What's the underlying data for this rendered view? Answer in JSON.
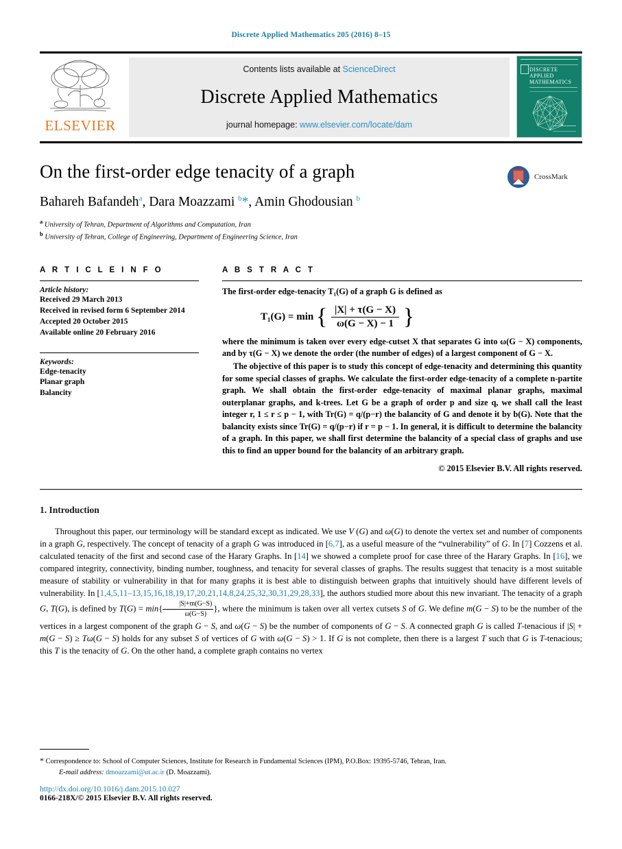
{
  "running_head": "Discrete Applied Mathematics 205 (2016) 8–15",
  "masthead": {
    "publisher_name": "ELSEVIER",
    "contents_prefix": "Contents lists available at ",
    "contents_link": "ScienceDirect",
    "journal_title": "Discrete Applied Mathematics",
    "homepage_prefix": "journal homepage: ",
    "homepage_link": "www.elsevier.com/locate/dam",
    "cover_title_line1": "DISCRETE",
    "cover_title_line2": "APPLIED",
    "cover_title_line3": "MATHEMATICS"
  },
  "article": {
    "title": "On the first-order edge tenacity of a graph",
    "authors_html": "Bahareh Bafandeh<sup>a</sup>, Dara Moazzami <sup>b</sup><span class=\"star\">*</span>, Amin Ghodousian <sup>b</sup>",
    "affiliation_a_marker": "a",
    "affiliation_a": "University of Tehran, Department of Algorithms and Computation, Iran",
    "affiliation_b_marker": "b",
    "affiliation_b": "University of Tehran, College of Engineering, Department of Engineering Science, Iran",
    "crossmark_label": "CrossMark"
  },
  "article_info": {
    "heading": "A R T I C L E   I N F O",
    "history_label": "Article history:",
    "history": [
      "Received 29 March 2013",
      "Received in revised form 6 September 2014",
      "Accepted 20 October 2015",
      "Available online 20 February 2016"
    ],
    "keywords_label": "Keywords:",
    "keywords": [
      "Edge-tenacity",
      "Planar graph",
      "Balancity"
    ]
  },
  "abstract": {
    "heading": "A B S T R A C T",
    "intro": "The first-order edge-tenacity T₁(G) of a graph G is defined as",
    "formula": {
      "lhs": "T₁(G) = min",
      "numerator": "|X| + τ(G − X)",
      "denominator": "ω(G − X) − 1"
    },
    "paragraph1": "where the minimum is taken over every edge-cutset X that separates G into ω(G − X) components, and by τ(G − X) we denote the order (the number of edges) of a largest component of G − X.",
    "paragraph2": "The objective of this paper is to study this concept of edge-tenacity and determining this quantity for some special classes of graphs. We calculate the first-order edge-tenacity of a complete n-partite graph. We shall obtain the first-order edge-tenacity of maximal planar graphs, maximal outerplanar graphs, and k-trees. Let G be a graph of order p and size q, we shall call the least integer r, 1 ≤ r ≤ p − 1, with Tr(G) = q/(p−r) the balancity of G and denote it by b(G). Note that the balancity exists since Tr(G) = q/(p−r) if r = p − 1. In general, it is difficult to determine the balancity of a graph. In this paper, we shall first determine the balancity of a special class of graphs and use this to find an upper bound for the balancity of an arbitrary graph.",
    "copyright": "© 2015 Elsevier B.V. All rights reserved."
  },
  "introduction": {
    "heading": "1.  Introduction",
    "paragraph_html": "Throughout this paper, our terminology will be standard except as indicated. We use <i>V</i> (<i>G</i>) and <i>ω</i>(<i>G</i>) to denote the vertex set and number of components in a graph <i>G</i>, respectively. The concept of tenacity of a graph <i>G</i> was introduced in [<span class=\"lnk\">6,7</span>], as a useful measure of the &ldquo;vulnerability&rdquo; of <i>G</i>. In [<span class=\"lnk\">7</span>] Cozzens et al. calculated tenacity of the first and second case of the Harary Graphs. In [<span class=\"lnk\">14</span>] we showed a complete proof for case three of the Harary Graphs. In [<span class=\"lnk\">16</span>], we compared integrity, connectivity, binding number, toughness, and tenacity for several classes of graphs. The results suggest that tenacity is a most suitable measure of stability or vulnerability in that for many graphs it is best able to distinguish between graphs that intuitively should have different levels of vulnerability. In [<span class=\"lnk\">1,4,5,11&ndash;13,15,16,18,19,17,20,21,14,8,24,25,32,30,31,29,28,33</span>], the authors studied more about this new invariant. The tenacity of a graph <i>G</i>, <i>T</i>(<i>G</i>), is defined by <i>T</i>(<i>G</i>) = <i>min</i>{<span style=\"display:inline-block;text-align:center;vertical-align:middle\"><span style=\"display:block;border-bottom:1px solid #000;font-size:10px;padding:0 2px\">|S|+m(G−S)</span><span style=\"display:block;font-size:10px\">ω(G−S)</span></span>}, where the minimum is taken over all vertex cutsets <i>S</i> of <i>G</i>. We define <i>m</i>(<i>G</i> − <i>S</i>) to be the number of the vertices in a largest component of the graph <i>G</i> − <i>S</i>, and <i>ω</i>(<i>G</i> − <i>S</i>) be the number of components of <i>G</i> − <i>S</i>. A connected graph <i>G</i> is called <i>T</i>-tenacious if |<i>S</i>| + <i>m</i>(<i>G</i> − <i>S</i>) &ge; <i>Tω</i>(<i>G</i> − <i>S</i>) holds for any subset <i>S</i> of vertices of <i>G</i> with <i>ω</i>(<i>G</i> − <i>S</i>) &gt; 1. If <i>G</i> is not complete, then there is a largest <i>T</i> such that <i>G</i> is <i>T</i>-tenacious; this <i>T</i> is the tenacity of <i>G</i>. On the other hand, a complete graph contains no vertex"
  },
  "footnotes": {
    "correspondence": "Correspondence to: School of Computer Sciences, Institute for Research in Fundamental Sciences (IPM), P.O.Box: 19395-5746, Tehran, Iran.",
    "email_label": "E-mail address:",
    "email": "dmoazzami@ut.ac.ir",
    "email_owner": "(D. Moazzami).",
    "doi": "http://dx.doi.org/10.1016/j.dam.2015.10.027",
    "issn": "0166-218X/© 2015 Elsevier B.V. All rights reserved."
  },
  "colors": {
    "link_blue": "#1a7fa8",
    "banner_link_blue": "#2b8fc0",
    "elsevier_orange": "#e87722",
    "cover_green": "#12806a"
  }
}
